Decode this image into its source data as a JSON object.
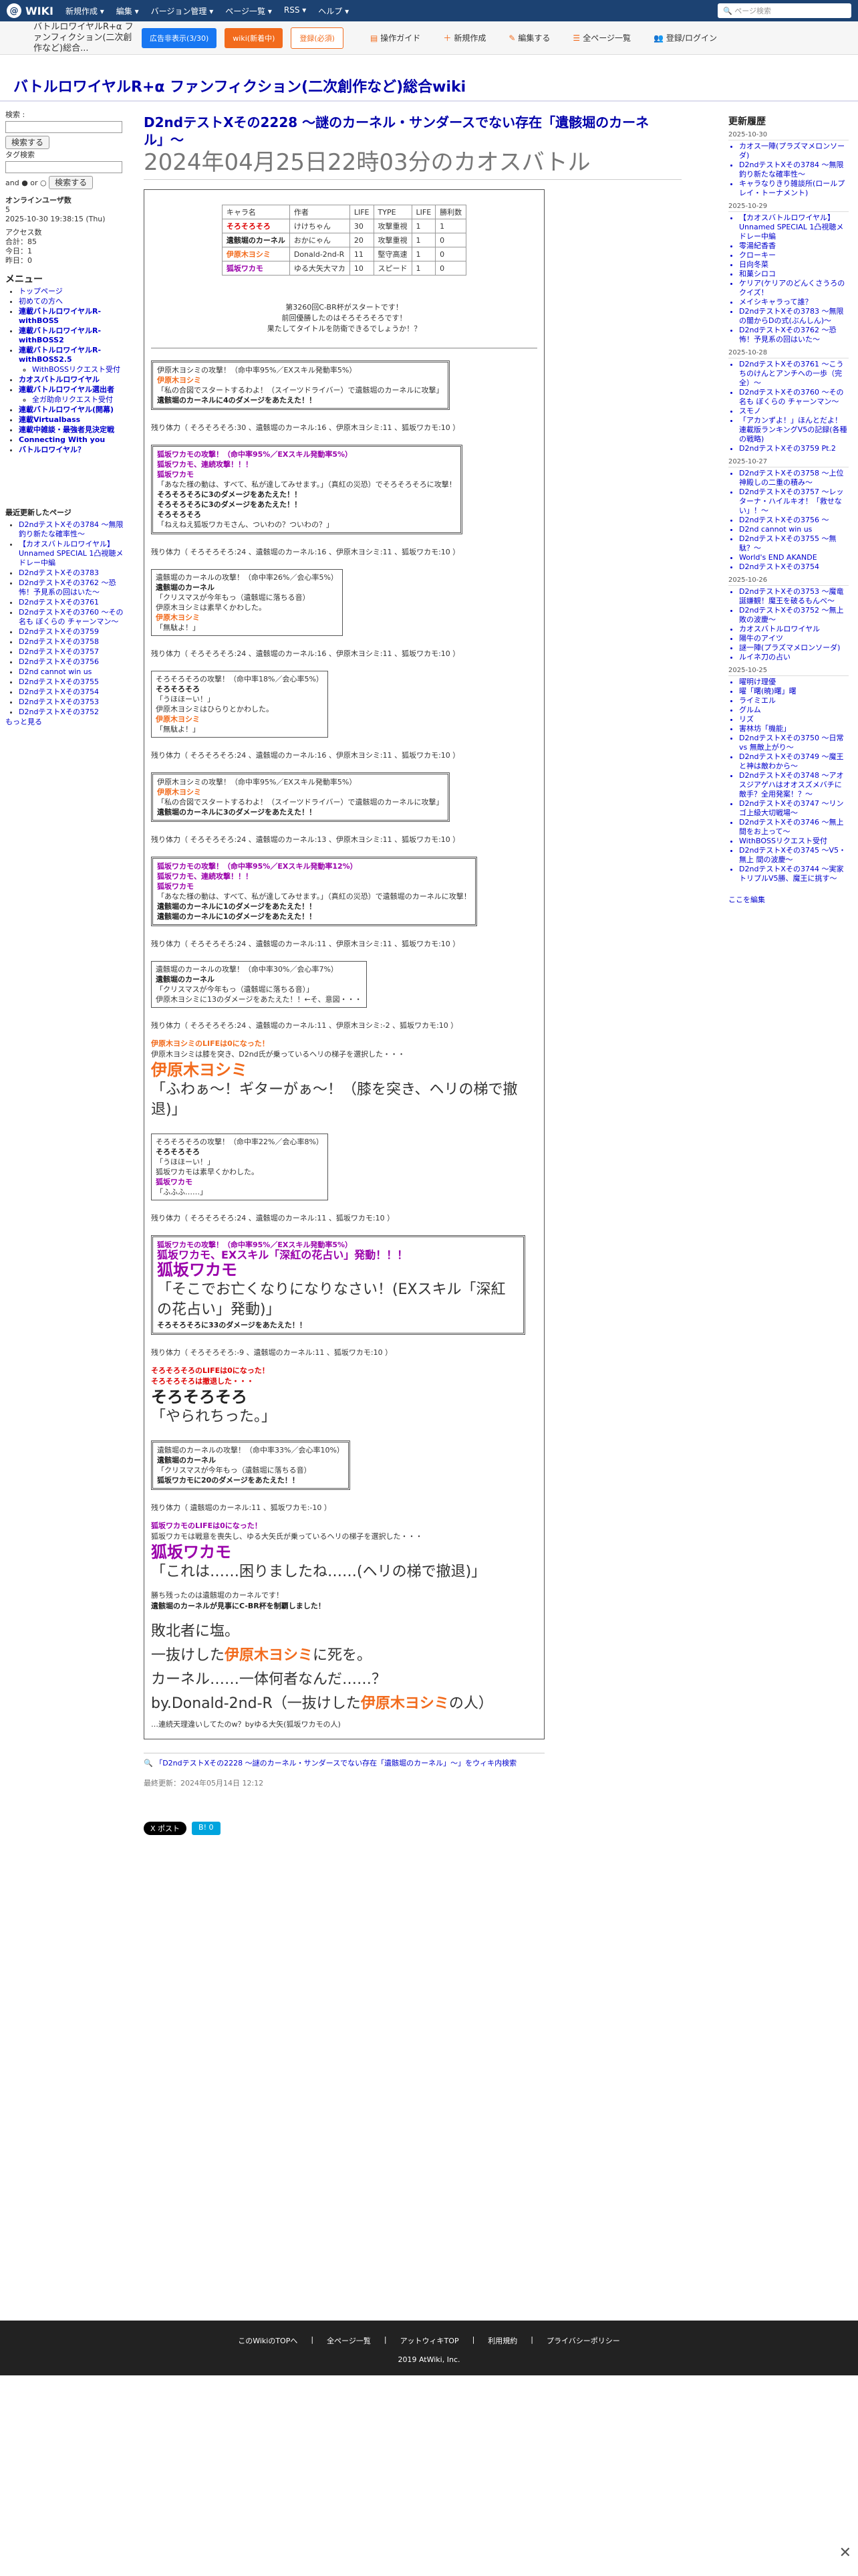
{
  "topbar": {
    "logo": "WIKI",
    "menu": [
      "新規作成 ▾",
      "編集 ▾",
      "バージョン管理 ▾",
      "ページ一覧 ▾",
      "RSS ▾",
      "ヘルプ ▾"
    ],
    "search_placeholder": "ページ検索"
  },
  "toolbar": {
    "wiki_short": "バトルロワイヤルR+α ファンフィクション(二次創作など)総合...",
    "btn_ad": "広告非表示(3/30)",
    "btn_atwiki": "wiki(新着中)",
    "btn_paid": "登録(必須)",
    "tools": [
      "操作ガイド",
      "新規作成",
      "編集する",
      "全ページ一覧",
      "登録/ログイン"
    ]
  },
  "page_title": "バトルロワイヤルR+α ファンフィクション(二次創作など)総合wiki",
  "left": {
    "search_label": "検索 :",
    "search_btn": "検索する",
    "tag_label": "タグ検索",
    "tag_btn": "検索する",
    "and_or": "and ● or ○",
    "online": "オンラインユーザ数",
    "online_val": "5",
    "updated": "2025-10-30 19:38:15 (Thu)",
    "access": "アクセス数",
    "total": "合計：85",
    "today": "今日：1",
    "yesterday": "昨日：0",
    "menu_title": "メニュー",
    "menu": [
      "トップページ",
      "初めての方へ",
      "連載バトルロワイヤルR-withBOSS",
      "連載バトルロワイヤルR-withBOSS2",
      "連載バトルロワイヤルR-withBOSS2.5",
      "WithBOSSリクエスト受付",
      "カオスバトルロワイヤル",
      "連載バトルロワイヤル選出者",
      "全ガ助命リクエスト受付",
      "連載バトルロワイヤル(開幕)",
      "連載Virtualbass",
      "連載中雑談・最強者見決定戦",
      "Connecting With you",
      "バトルロワイヤル？"
    ],
    "sub_title": "最近更新したページ",
    "recent": [
      "D2ndテストXその3784 〜無限釣り新たな確率性〜",
      "【カオスバトルロワイヤル】Unnamed SPECIAL 1凸視聴メドレー中編",
      "D2ndテストXその3783",
      "D2ndテストXその3762 〜恐怖！予見系の回はいた〜",
      "D2ndテストXその3761",
      "D2ndテストXその3760 〜その名も ぼくらの チャーンマン〜",
      "D2ndテストXその3759",
      "D2ndテストXその3758",
      "D2ndテストXその3757",
      "D2ndテストXその3756",
      "D2nd cannot win us",
      "D2ndテストXその3755",
      "D2ndテストXその3754",
      "D2ndテストXその3753",
      "D2ndテストXその3752"
    ],
    "more": "もっと見る"
  },
  "main": {
    "title": "D2ndテストXその2228 〜謎のカーネル・サンダースでない存在「遺骸堀のカーネル」〜",
    "subtitle": "2024年04月25日22時03分のカオスバトル",
    "table_head": [
      "キャラ名",
      "作者",
      "LIFE",
      "TYPE",
      "LIFE",
      "勝利数"
    ],
    "table_rows": [
      [
        "そろそろそろ",
        "けけちゃん",
        "30",
        "攻撃重視",
        "1",
        "1"
      ],
      [
        "遺骸堀のカーネル",
        "おかにゃん",
        "20",
        "攻撃重視",
        "1",
        "0"
      ],
      [
        "伊原木ヨシミ",
        "Donald-2nd-R",
        "11",
        "堅守高速",
        "1",
        "0"
      ],
      [
        "狐坂ワカモ",
        "ゆる大矢大マカ",
        "10",
        "スピード",
        "1",
        "0"
      ]
    ],
    "intro1": "第3260回C-BR杯がスタートです！",
    "intro2": "前回優勝したのはそろそろそろです！",
    "intro3": "果たしてタイトルを防衛できるでしょうか！？",
    "r1a": "伊原木ヨシミの攻撃！（命中率95%／EXスキル発動率5%）",
    "r1b": "伊原木ヨシミ",
    "r1c": "「私の合図でスタートするわよ！（スイーツドライバー）で遺骸堀のカーネルに攻撃」",
    "r1d": "遺骸堀のカーネルに4のダメージをあたえた！！",
    "hp1": "残り体力（ そろそろそろ:30 、遺骸堀のカーネル:16 、伊原木ヨシミ:11 、狐坂ワカモ:10 ）",
    "r2a": "狐坂ワカモの攻撃！（命中率95%／EXスキル発動率5%）",
    "r2b": "狐坂ワカモ、連続攻撃！！！",
    "r2c": "狐坂ワカモ",
    "r2d": "「あなた様の動は、すべて、私が達してみせます。」（真紅の災恐）でそろそろそろに攻撃！",
    "r2e": "そろそろそろに3のダメージをあたえた！！",
    "r2f": "そろそろそろに3のダメージをあたえた！！",
    "r2g": "そろそろそろ",
    "r2h": "「ねえねえ狐坂ワカモさん、ついわの？ついわの？」",
    "hp2": "残り体力（ そろそろそろ:24 、遺骸堀のカーネル:16 、伊原木ヨシミ:11 、狐坂ワカモ:10 ）",
    "r3a": "遺骸堀のカーネルの攻撃！（命中率26%／会心率5%）",
    "r3b": "遺骸堀のカーネル",
    "r3c": "「クリスマスが今年もっ（遺骸堀に落ちる音）",
    "r3d": "伊原木ヨシミは素早くかわした。",
    "r3e": "伊原木ヨシミ",
    "r3f": "「無駄よ！」",
    "hp3": "残り体力（ そろそろそろ:24 、遺骸堀のカーネル:16 、伊原木ヨシミ:11 、狐坂ワカモ:10 ）",
    "r4a": "そろそろそろの攻撃！（命中率18%／会心率5%）",
    "r4b": "そろそろそろ",
    "r4c": "「うほほーい！」",
    "r4d": "伊原木ヨシミはひらりとかわした。",
    "r4e": "伊原木ヨシミ",
    "r4f": "「無駄よ！」",
    "hp4": "残り体力（ そろそろそろ:24 、遺骸堀のカーネル:16 、伊原木ヨシミ:11 、狐坂ワカモ:10 ）",
    "r5a": "伊原木ヨシミの攻撃！（命中率95%／EXスキル発動率5%）",
    "r5b": "伊原木ヨシミ",
    "r5c": "「私の合図でスタートするわよ！（スイーツドライバー）で遺骸堀のカーネルに攻撃」",
    "r5d": "遺骸堀のカーネルに3のダメージをあたえた！！",
    "hp5": "残り体力（ そろそろそろ:24 、遺骸堀のカーネル:13 、伊原木ヨシミ:11 、狐坂ワカモ:10 ）",
    "r6a": "狐坂ワカモの攻撃！（命中率95%／EXスキル発動率12%）",
    "r6b": "狐坂ワカモ、連続攻撃！！！",
    "r6c": "狐坂ワカモ",
    "r6d": "「あなた様の動は、すべて、私が達してみせます。」（真紅の災恐）で遺骸堀のカーネルに攻撃！",
    "r6e": "遺骸堀のカーネルに1のダメージをあたえた！！",
    "r6f": "遺骸堀のカーネルに1のダメージをあたえた！！",
    "hp6": "残り体力（ そろそろそろ:24 、遺骸堀のカーネル:11 、伊原木ヨシミ:11 、狐坂ワカモ:10 ）",
    "r7a": "遺骸堀のカーネルの攻撃！（命中率30%／会心率7%）",
    "r7b": "遺骸堀のカーネル",
    "r7c": "「クリスマスが今年もっ（遺骸堀に落ちる音）」",
    "r7d": "伊原木ヨシミに13のダメージをあたえた！！←そ、意図・・・",
    "hp7": "残り体力（ そろそろそろ:24 、遺骸堀のカーネル:11 、伊原木ヨシミ:-2 、狐坂ワカモ:10 ）",
    "d1a": "伊原木ヨシミのLIFEは0になった！",
    "d1b": "伊原木ヨシミは膝を突き、D2nd氏が乗っているヘリの梯子を選択した・・・",
    "d1c": "伊原木ヨシミ",
    "d1d": "「ふわぁ〜！ギターがぁ〜！（膝を突き、ヘリの梯で撤退)」",
    "r8a": "そろそろそろの攻撃！（命中率22%／会心率8%）",
    "r8b": "そろそろそろ",
    "r8c": "「うほほーい！」",
    "r8d": "狐坂ワカモは素早くかわした。",
    "r8e": "狐坂ワカモ",
    "r8f": "「ふふふ……」",
    "hp8": "残り体力（ そろそろそろ:24 、遺骸堀のカーネル:11 、狐坂ワカモ:10 ）",
    "r9a": "狐坂ワカモの攻撃！（命中率95%／EXスキル発動率5%）",
    "r9b": "狐坂ワカモ、EXスキル「深紅の花占い」発動！！！",
    "r9c": "狐坂ワカモ",
    "r9d": "「そこでお亡くなりになりなさい！(EXスキル「深紅の花占い」発動)」",
    "r9e": "そろそろそろに33のダメージをあたえた！！",
    "hp9": "残り体力（ そろそろそろ:-9 、遺骸堀のカーネル:11 、狐坂ワカモ:10 ）",
    "d2a": "そろそろそろのLIFEは0になった！",
    "d2b": "そろそろそろは撤退した・・・",
    "d2c": "そろそろそろ",
    "d2d": "「やられちった。」",
    "r10a": "遺骸堀のカーネルの攻撃！（命中率33%／会心率10%）",
    "r10b": "遺骸堀のカーネル",
    "r10c": "「クリスマスが今年もっ（遺骸堀に落ちる音）",
    "r10d": "狐坂ワカモに20のダメージをあたえた！！",
    "hp10": "残り体力（ 遺骸堀のカーネル:11 、狐坂ワカモ:-10 ）",
    "d3a": "狐坂ワカモのLIFEは0になった！",
    "d3b": "狐坂ワカモは戦意を喪失し、ゆる大矢氏が乗っているヘリの梯子を選択した・・・",
    "d3c": "狐坂ワカモ",
    "d3d": "「これは……困りましたね……(ヘリの梯で撤退)」",
    "w1": "勝ち残ったのは遺骸堀のカーネルです！",
    "w2": "遺骸堀のカーネルが見事にC-BR杯を制覇しました！",
    "c1": "敗北者に塩。",
    "c2a": "一抜けした",
    "c2b": "伊原木ヨシミ",
    "c2c": "に死を。",
    "c3": "カーネル……一体何者なんだ……？",
    "c4a": "by.Donald-2nd-R（一抜けした",
    "c4b": "伊原木ヨシミ",
    "c4c": "の人）",
    "c5": "…連続天理違いしてたのw？byゆる大矢(狐坂ワカモの人)",
    "foot_link": "「D2ndテストXその2228 〜謎のカーネル・サンダースでない存在「遺骸堀のカーネル」〜」をウィキ内検索",
    "updated": "最終更新：2024年05月14日 12:12",
    "share_x": "X ポスト",
    "share_b": "B! 0"
  },
  "right": {
    "title": "更新履歴",
    "groups": [
      {
        "date": "2025-10-30",
        "items": [
          "カオス一陣(プラズマメロンソーダ)",
          "D2ndテストXその3784 〜無限釣り新たな確率性〜",
          "キャラなりきり雑談所(ロールプレイ・トーナメント)"
        ]
      },
      {
        "date": "2025-10-29",
        "items": [
          "【カオスバトルロワイヤル】Unnamed SPECIAL 1凸視聴メドレー中編",
          "零湯紀香香",
          "クローキー",
          "日向冬菜",
          "和菓シロコ",
          "ケリア(ケリアのどんくさうろのクイズ！",
          "メイシキャラって誰？",
          "D2ndテストXその3783 〜無限の闇からDの式(ぶんしん)〜",
          "D2ndテストXその3762 〜恐怖！予見系の回はいた〜"
        ]
      },
      {
        "date": "2025-10-28",
        "items": [
          "D2ndテストXその3761 〜こうちのけんとアンチへの一歩（完全）〜",
          "D2ndテストXその3760 〜その名も ぼくらの チャーンマン〜",
          "スモノ",
          "「アカンずよ！」ほんとだよ！ 連載版ランキングV5の記録(各種の戦略)",
          "D2ndテストXその3759 Pt.2"
        ]
      },
      {
        "date": "2025-10-27",
        "items": [
          "D2ndテストXその3758 〜上位神殿しの二重の積み〜",
          "D2ndテストXその3757 〜レッターナ・ハイルキオ！「救せない」！〜",
          "D2ndテストXその3756 〜",
          "D2nd cannot win us",
          "D2ndテストXその3755 〜無駄？〜",
          "World's END AKANDE",
          "D2ndテストXその3754"
        ]
      },
      {
        "date": "2025-10-26",
        "items": [
          "D2ndテストXその3753 〜魔竜誕嫌観！魔王を破るもんべ〜",
          "D2ndテストXその3752 〜無上 敗の波慶〜",
          "カオスバトルロワイヤル",
          "陽牛のアイツ",
          "謎一陣(プラズマメロンソーダ)",
          "ルイネ刀の占い"
        ]
      },
      {
        "date": "2025-10-25",
        "items": [
          "曜明け理優",
          "曜「曙(暁)曙」曙",
          "ライミエル",
          "グルム",
          "リズ",
          "害林坊「機能」",
          "D2ndテストXその3750 〜日常 vs 無敵上がり〜",
          "D2ndテストXその3749 〜魔王と神は敵わから〜",
          "D2ndテストXその3748 〜アオスジアゲハはオオスズメバチに敵手？全用発案！？〜",
          "D2ndテストXその3747 〜リンゴ上級大切戦場〜",
          "D2ndテストXその3746 〜無上 間をお上って〜",
          "WithBOSSリクエスト受付",
          "D2ndテストXその3745 〜V5・無上 間の波慶〜",
          "D2ndテストXその3744 〜実家トリプルV5勝、魔王に挑す〜"
        ]
      }
    ],
    "edit": "ここを編集"
  },
  "footer": {
    "links": [
      "このWikiのTOPへ",
      "全ページ一覧",
      "アットウィキTOP",
      "利用規約",
      "プライバシーポリシー"
    ],
    "copy": "2019 AtWiki, Inc."
  }
}
